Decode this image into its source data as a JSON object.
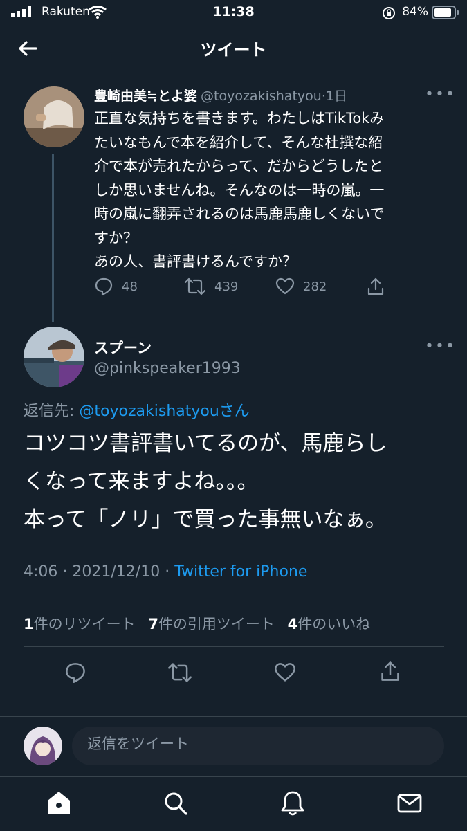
{
  "status_bar": {
    "carrier": "Rakuten",
    "time": "11:38",
    "battery": "84%"
  },
  "header": {
    "title": "ツイート"
  },
  "parent_tweet": {
    "name": "豊崎由美≒とよ婆",
    "handle": "@toyozakishatyou",
    "separator": "·",
    "age": "1日",
    "text_lines": [
      "正直な気持ちを書きます。わたしはTikTokみ",
      "たいなもんで本を紹介して、そんな杜撰な紹",
      "介で本が売れたからって、だからどうしたと",
      "しか思いませんね。そんなのは一時の嵐。一",
      "時の嵐に翻弄されるのは馬鹿馬鹿しくないで",
      "すか？",
      "あの人、書評書けるんですか？"
    ],
    "replies": "48",
    "retweets": "439",
    "likes": "282"
  },
  "main_tweet": {
    "name": "スプーン",
    "handle": "@pinkspeaker1993",
    "reply_prefix": "返信先: ",
    "reply_to": "@toyozakishatyou",
    "reply_suffix": "さん",
    "text_lines": [
      "コツコツ書評書いてるのが、馬鹿らし",
      "くなって来ますよね。。。",
      "本って「ノリ」で買った事無いなぁ。"
    ],
    "time": "4:06",
    "date": "2021/12/10",
    "meta_sep1": " · ",
    "meta_sep2": " · ",
    "source": "Twitter for iPhone",
    "stats": {
      "retweets_count": "1",
      "retweets_label": "件のリツイート",
      "quotes_count": "7",
      "quotes_label": "件の引用ツイート",
      "likes_count": "4",
      "likes_label": "件のいいね"
    }
  },
  "reply_composer": {
    "placeholder": "返信をツイート"
  },
  "colors": {
    "background": "#15202b",
    "accent": "#1d9bf0",
    "secondary_text": "#8b98a5",
    "divider": "#38444d"
  },
  "icons": [
    "back-arrow-icon",
    "reply-icon",
    "retweet-icon",
    "like-icon",
    "share-icon",
    "home-icon",
    "search-icon",
    "notifications-icon",
    "messages-icon",
    "more-icon"
  ]
}
